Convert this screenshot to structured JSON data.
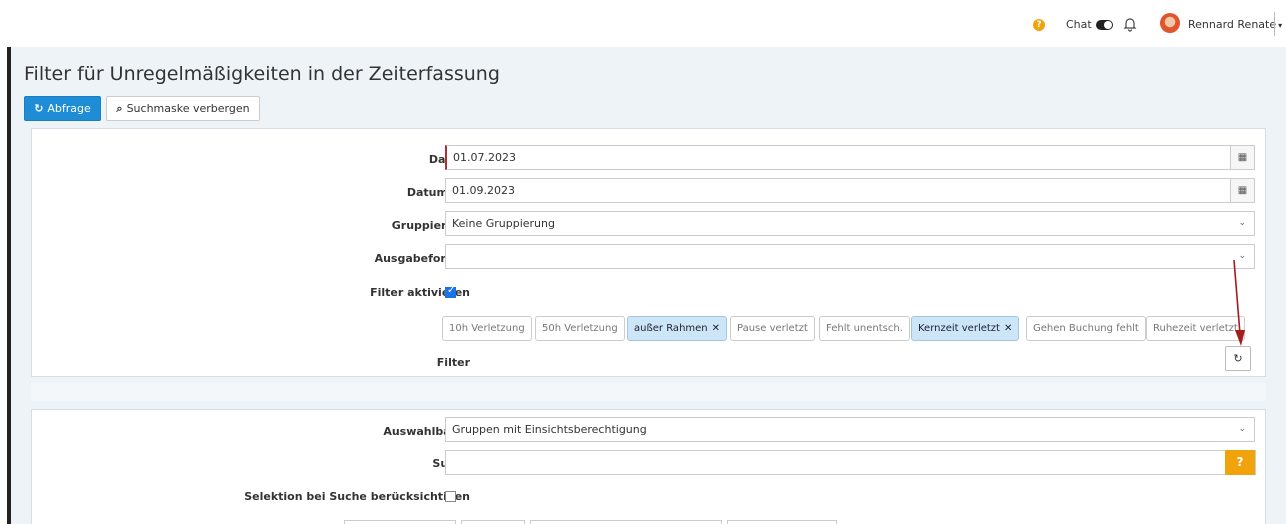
{
  "topbar": {
    "help_glyph": "?",
    "chat_label": "Chat",
    "user_name": "Rennard Renate",
    "user_caret": "▾",
    "icons": [
      "help-circle-icon",
      "toggle-icon",
      "bell-icon",
      "avatar"
    ]
  },
  "page": {
    "title": "Filter für Unregelmäßigkeiten in der Zeiterfassung",
    "query_button": "Abfrage",
    "query_icon": "↻",
    "hide_mask_button": "Suchmaske verbergen",
    "hide_mask_icon": "⌕"
  },
  "form": {
    "date_label": "Datum",
    "date_value": "01.07.2023",
    "date_to_label": "Datum bis",
    "date_to_value": "01.09.2023",
    "grouping_label": "Gruppierung",
    "grouping_value": "Keine Gruppierung",
    "output_label": "Ausgabeformat",
    "output_value": "",
    "filter_active_label": "Filter aktivieren",
    "filter_active_checked": true,
    "filter_label": "Filter",
    "chips": [
      {
        "label": "10h Verletzung",
        "selected": false
      },
      {
        "label": "50h Verletzung",
        "selected": false
      },
      {
        "label": "außer Rahmen",
        "selected": true
      },
      {
        "label": "Pause verletzt",
        "selected": false
      },
      {
        "label": "Fehlt unentsch.",
        "selected": false
      },
      {
        "label": "Kernzeit verletzt",
        "selected": true
      },
      {
        "label": "Gehen Buchung fehlt",
        "selected": false
      },
      {
        "label": "Ruhezeit verletzt",
        "selected": false
      }
    ],
    "chip_remove_glyph": "✕",
    "calendar_glyph": "▦",
    "caret_glyph": "⌄",
    "refresh_glyph": "↻"
  },
  "selection": {
    "tree_label": "Auswahlbaum",
    "tree_value": "Gruppen mit Einsichtsberechtigung",
    "search_label": "Suche",
    "search_value": "",
    "search_help": "?",
    "consider_label": "Selektion bei Suche berücksichtigen",
    "consider_checked": false
  },
  "colors": {
    "primary": "#1f8dd6",
    "chip_selected": "#cde6f7",
    "warning": "#f0a30a",
    "annotation_arrow": "#a31d1d"
  }
}
